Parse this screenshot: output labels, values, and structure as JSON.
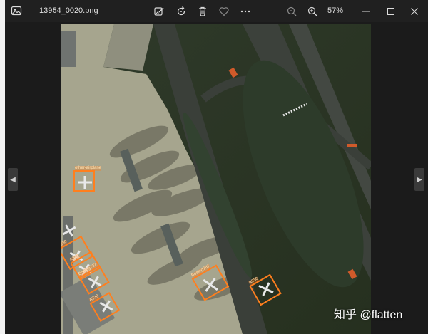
{
  "window": {
    "filename": "13954_0020.png",
    "zoom": "57%"
  },
  "toolbar": {
    "icons": [
      "image-app-icon",
      "edit-image-icon",
      "rotate-icon",
      "delete-icon",
      "favorite-heart-icon",
      "more-icon",
      "zoom-out-icon",
      "zoom-in-icon"
    ]
  },
  "detections": [
    {
      "label": "other-airplane"
    },
    {
      "label": "A330"
    },
    {
      "label": "A321"
    },
    {
      "label": "Boeing737"
    },
    {
      "label": "A330"
    },
    {
      "label": "Boeing787"
    },
    {
      "label": "A330"
    }
  ],
  "watermark": "知乎 @flatten",
  "colors": {
    "box": "#ff7f1e",
    "titlebar": "#202020",
    "background": "#1b1b1b"
  }
}
